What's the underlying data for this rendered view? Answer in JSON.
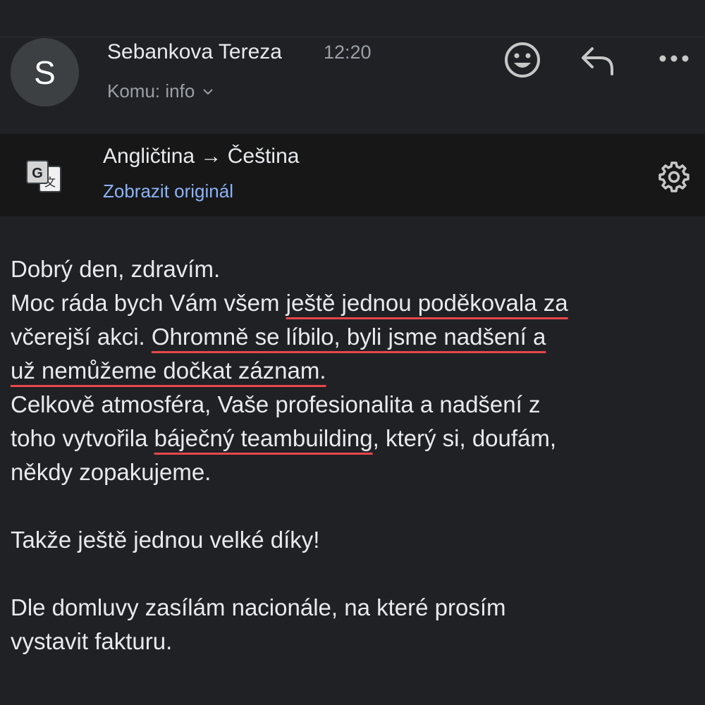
{
  "header": {
    "avatar_letter": "S",
    "sender": "Sebankova Tereza",
    "time": "12:20",
    "recipient": "Komu: info",
    "icons": [
      "emoji-icon",
      "reply-icon",
      "more-icon"
    ]
  },
  "translation": {
    "languages": "Angličtina → Čeština",
    "show_original": "Zobrazit originál",
    "icons": [
      "google-translate-icon",
      "settings-icon"
    ]
  },
  "body": {
    "l1": "Dobrý den, zdravím.",
    "l2a": "Moc ráda bych Vám všem ",
    "l2b": "ještě jednou poděkovala za",
    "l3a": "včerejší akci. ",
    "l3b": "Ohromně se líbilo, byli jsme nadšení a",
    "l4": "už nemůžeme dočkat záznam.",
    "l5": "Celkově atmosféra, Vaše profesionalita a nadšení z",
    "l6a": "toho vytvořila ",
    "l6b": "báječný teambuilding",
    "l6c": ", který si, doufám,",
    "l7": "někdy zopakujeme.",
    "l8": "Takže ještě jednou velké díky!",
    "l9": "Dle domluvy zasílám nacionále, na které prosím",
    "l10": "vystavit fakturu."
  },
  "colors": {
    "background": "#202124",
    "translate_bar": "#171717",
    "link": "#8ab4f8",
    "underline": "#e8474c"
  }
}
